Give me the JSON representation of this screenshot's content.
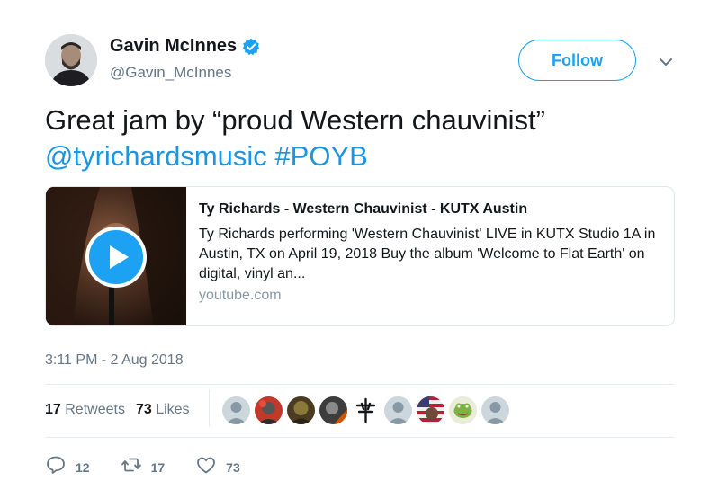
{
  "author": {
    "display_name": "Gavin McInnes",
    "handle": "@Gavin_McInnes",
    "verified": true
  },
  "follow_label": "Follow",
  "tweet": {
    "text_line1": "Great jam by “proud Western chauvinist”",
    "mention": "@tyrichardsmusic",
    "hashtag": "#POYB"
  },
  "card": {
    "title": "Ty Richards - Western Chauvinist - KUTX Austin",
    "description": "Ty Richards performing 'Western Chauvinist' LIVE in KUTX Studio 1A in Austin, TX on April 19, 2018 Buy the album 'Welcome to Flat Earth' on digital, vinyl an...",
    "domain": "youtube.com"
  },
  "timestamp": "3:11 PM - 2 Aug 2018",
  "stats": {
    "retweets_count": "17",
    "retweets_label": "Retweets",
    "likes_count": "73",
    "likes_label": "Likes"
  },
  "actions": {
    "reply_count": "12",
    "retweet_count": "17",
    "like_count": "73"
  },
  "colors": {
    "accent": "#1da1f2",
    "link": "#1b95e0",
    "muted": "#657786"
  }
}
